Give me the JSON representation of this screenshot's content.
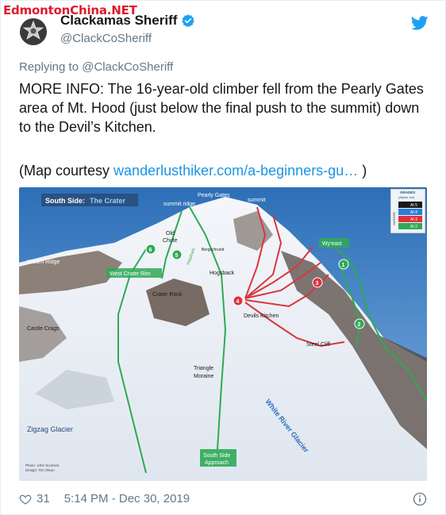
{
  "watermark": "EdmontonChina.NET",
  "account": {
    "display_name": "Clackamas Sheriff",
    "handle": "@ClackCoSheriff"
  },
  "reply": {
    "prefix": "Replying to",
    "mention": "@ClackCoSheriff"
  },
  "tweet": {
    "text": "MORE INFO: The 16-year-old climber fell from the Pearly Gates area of Mt. Hood (just below the final push to the summit) down to the Devil’s Kitchen.",
    "credit_prefix": "(Map courtesy ",
    "credit_link": "wanderlusthiker.com/a-beginners-gu…",
    "credit_suffix": " )"
  },
  "map": {
    "title_left": "South Side:",
    "title_right": "The Crater",
    "labels": {
      "pearly_gates": "Pearly Gates",
      "summit": "summit",
      "summit_ridge": "summit ridge",
      "old_chute_1": "Old",
      "old_chute_2": "Chute",
      "bergschrund": "Bergschrund",
      "hogsback": "Hogsback",
      "wy_east": "Wy'east",
      "yocum_ridge": "Yocum Ridge",
      "west_crater_rim": "West Crater Rim",
      "crater_rock": "Crater Rock",
      "devils_kitchen": "Devils Kitchen",
      "castle_crags": "Castle Crags",
      "steel_cliff": "Steel Cliff",
      "triangle_1": "Triangle",
      "triangle_2": "Moraine",
      "zigzag": "Zigzag Glacier",
      "white_river": "White River Glacier",
      "approach_1": "South Side",
      "approach_2": "Approach",
      "photo_credit_1": "Photo: John Scurlock",
      "photo_credit_2": "Design: Tim Olson",
      "hogsback_route": "Hogsback"
    },
    "route_numbers": [
      "1",
      "2",
      "3",
      "4",
      "5",
      "6"
    ],
    "legend": {
      "title": "GRADES",
      "subtitle": "(Alpine Ice)",
      "harder": "HARDER",
      "grades": [
        "AI 5",
        "AI 4",
        "AI 3",
        "AI 2"
      ],
      "colors": [
        "#1a1a1a",
        "#2a7fd4",
        "#e0303a",
        "#2eaa55"
      ]
    }
  },
  "footer": {
    "likes": "31",
    "timestamp": "5:14 PM - Dec 30, 2019"
  },
  "colors": {
    "twitter_blue": "#1da1f2",
    "link": "#1b95e0",
    "secondary_text": "#657786",
    "route_green": "#2eaa55",
    "route_red": "#d9363e"
  }
}
